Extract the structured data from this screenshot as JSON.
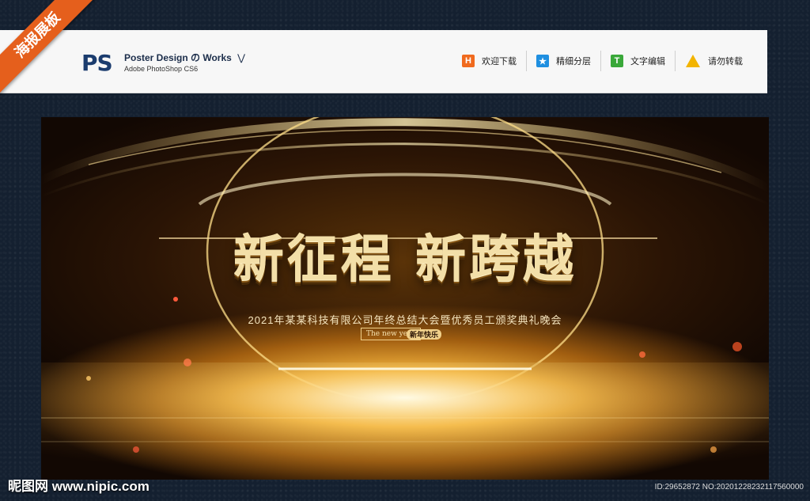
{
  "ribbon": {
    "label": "海报展板"
  },
  "header": {
    "logo": "PS",
    "title": "Poster Design の Works",
    "title_chevron": "⋁",
    "subtitle": "Adobe PhotoShop CS6"
  },
  "toolbar": {
    "items": [
      {
        "icon": "H",
        "icon_name": "h-icon",
        "color": "#f06a1e",
        "label": "欢迎下载"
      },
      {
        "icon": "★",
        "icon_name": "star-icon",
        "color": "#1f8fe0",
        "label": "精细分层"
      },
      {
        "icon": "T",
        "icon_name": "text-icon",
        "color": "#3aa83a",
        "label": "文字编辑"
      },
      {
        "icon": "!",
        "icon_name": "warning-icon",
        "color": "#f2b400",
        "label": "请勿转载"
      }
    ]
  },
  "poster": {
    "headline": "新征程 新跨越",
    "subtitle": "2021年某某科技有限公司年终总结大会暨优秀员工颁奖典礼晚会",
    "badge_en": "The new year",
    "badge_cn": "新年快乐"
  },
  "footer": {
    "watermark": "昵图网 www.nipic.com",
    "id_text": "ID:29652872 NO:20201228232117560000"
  }
}
